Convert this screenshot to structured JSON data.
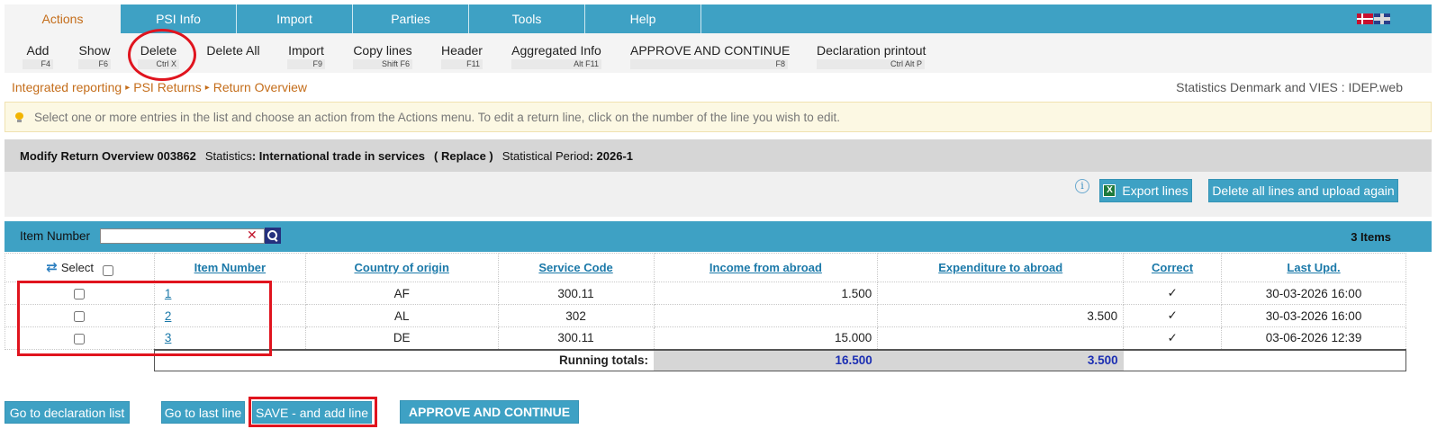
{
  "tabs": [
    {
      "label": "Actions",
      "active": true
    },
    {
      "label": "PSI Info"
    },
    {
      "label": "Import"
    },
    {
      "label": "Parties"
    },
    {
      "label": "Tools"
    },
    {
      "label": "Help"
    }
  ],
  "actions": [
    {
      "label": "Add",
      "shortcut": "F4"
    },
    {
      "label": "Show",
      "shortcut": "F6"
    },
    {
      "label": "Delete",
      "shortcut": "Ctrl X"
    },
    {
      "label": "Delete All",
      "shortcut": ""
    },
    {
      "label": "Import",
      "shortcut": "F9"
    },
    {
      "label": "Copy lines",
      "shortcut": "Shift F6"
    },
    {
      "label": "Header",
      "shortcut": "F11"
    },
    {
      "label": "Aggregated Info",
      "shortcut": "Alt F11"
    },
    {
      "label": "APPROVE AND CONTINUE",
      "shortcut": "F8"
    },
    {
      "label": "Declaration printout",
      "shortcut": "Ctrl Alt P"
    }
  ],
  "breadcrumb": [
    "Integrated reporting",
    "PSI Returns",
    "Return Overview"
  ],
  "app_title": "Statistics Denmark and VIES : IDEP.web",
  "info_message": "Select one or more entries in the list and choose an action from the Actions menu. To edit a return line, click on the number of the line you wish to edit.",
  "header": {
    "title": "Modify Return Overview 003862",
    "statistics_label": "Statistics",
    "statistics_value": ": International trade in services",
    "mode": "( Replace )",
    "period_label": "Statistical Period",
    "period_value": ": 2026-1"
  },
  "buttons": {
    "export": "Export lines",
    "delete_upload": "Delete all lines and upload again",
    "go_declaration": "Go to declaration list",
    "go_last": "Go to last line",
    "save_add": "SAVE - and add line",
    "approve": "APPROVE AND CONTINUE"
  },
  "filter": {
    "label": "Item Number",
    "value": "",
    "count": "3 Items"
  },
  "table": {
    "select_label": "Select",
    "headers": [
      "Item Number",
      "Country of origin",
      "Service Code",
      "Income from abroad",
      "Expenditure to abroad",
      "Correct",
      "Last Upd."
    ],
    "rows": [
      {
        "item": "1",
        "country": "AF",
        "service": "300.11",
        "income": "1.500",
        "expenditure": "",
        "correct": "✓",
        "updated": "30-03-2026 16:00"
      },
      {
        "item": "2",
        "country": "AL",
        "service": "302",
        "income": "",
        "expenditure": "3.500",
        "correct": "✓",
        "updated": "30-03-2026 16:00"
      },
      {
        "item": "3",
        "country": "DE",
        "service": "300.11",
        "income": "15.000",
        "expenditure": "",
        "correct": "✓",
        "updated": "03-06-2026 12:39"
      }
    ],
    "totals_label": "Running totals:",
    "total_income": "16.500",
    "total_expenditure": "3.500"
  }
}
